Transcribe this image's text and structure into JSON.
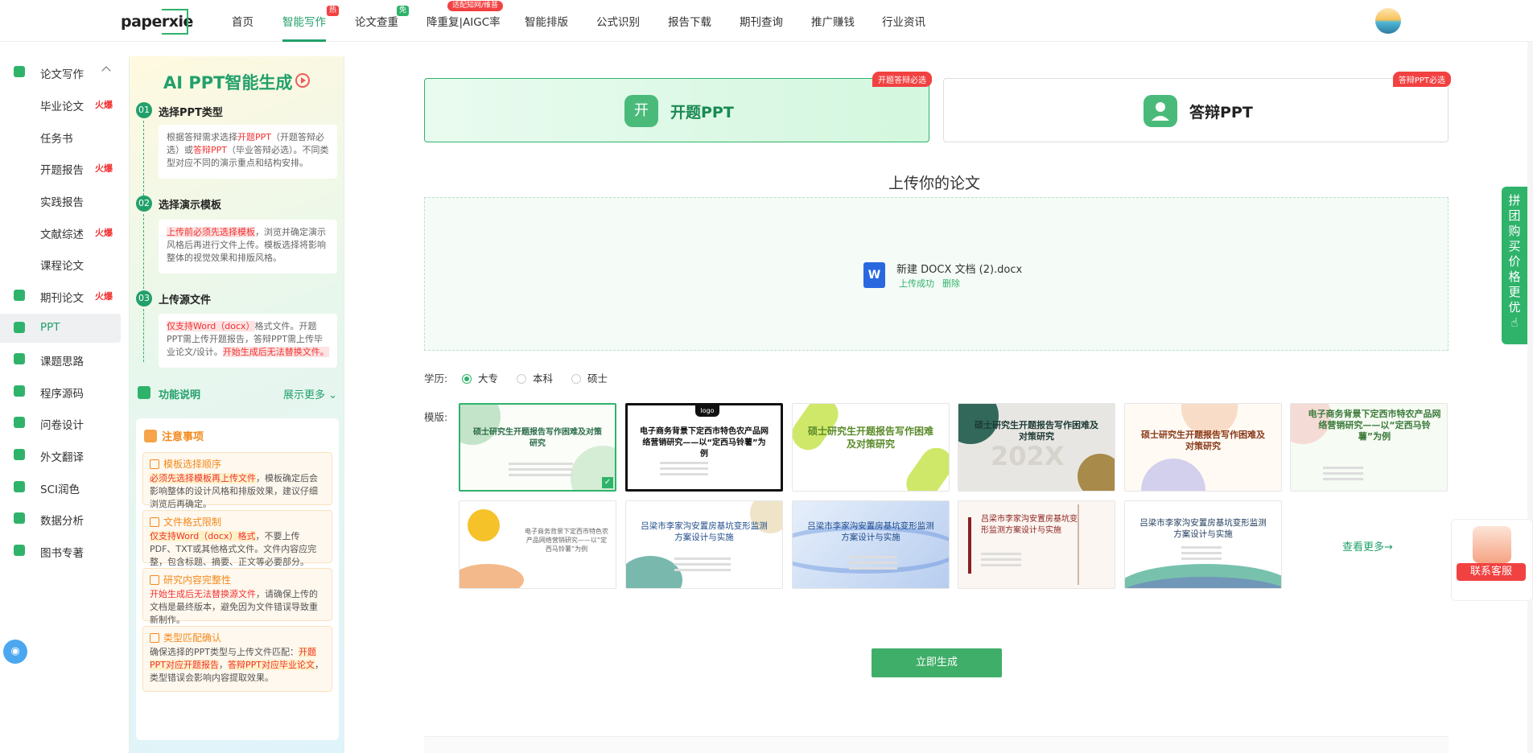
{
  "brand": {
    "logo_text": "paperxie"
  },
  "nav": {
    "items": [
      {
        "label": "首页"
      },
      {
        "label": "智能写作",
        "badge": "热"
      },
      {
        "label": "论文查重",
        "badge": "免"
      },
      {
        "label": "降重复|AIGC率",
        "badge": "适配知网/维普"
      },
      {
        "label": "智能排版"
      },
      {
        "label": "公式识别"
      },
      {
        "label": "报告下载"
      },
      {
        "label": "期刊查询"
      },
      {
        "label": "推广赚钱"
      },
      {
        "label": "行业资讯"
      }
    ]
  },
  "sidebar": {
    "items": [
      {
        "label": "论文写作",
        "hot": ""
      },
      {
        "label": "毕业论文",
        "hot": "火爆"
      },
      {
        "label": "任务书",
        "hot": ""
      },
      {
        "label": "开题报告",
        "hot": "火爆"
      },
      {
        "label": "实践报告",
        "hot": ""
      },
      {
        "label": "文献综述",
        "hot": "火爆"
      },
      {
        "label": "课程论文",
        "hot": ""
      },
      {
        "label": "期刊论文",
        "hot": "火爆"
      },
      {
        "label": "PPT",
        "hot": ""
      },
      {
        "label": "课题思路",
        "hot": ""
      },
      {
        "label": "程序源码",
        "hot": ""
      },
      {
        "label": "问卷设计",
        "hot": ""
      },
      {
        "label": "外文翻译",
        "hot": ""
      },
      {
        "label": "SCI润色",
        "hot": ""
      },
      {
        "label": "数据分析",
        "hot": ""
      },
      {
        "label": "图书专著",
        "hot": ""
      }
    ]
  },
  "guide": {
    "title": "AI PPT智能生成",
    "steps": [
      {
        "num": "01",
        "title": "选择PPT类型",
        "t1": "根据答辩需求选择",
        "t2": "开题PPT",
        "t3": "（开题答辩必选）或",
        "t4": "答辩PPT",
        "t5": "（毕业答辩必选）。不同类型对应不同的演示重点和结构安排。"
      },
      {
        "num": "02",
        "title": "选择演示模板",
        "t1": "上传前必须先选择模板",
        "t2": "，浏览并确定演示风格后再进行文件上传。模板选择将影响整体的视觉效果和排版风格。"
      },
      {
        "num": "03",
        "title": "上传源文件",
        "t1": "仅支持Word（docx）",
        "t2": "格式文件。开题PPT需上传开题报告，答辩PPT需上传毕业论文/设计。",
        "t3": "开始生成后无法替换文件。"
      }
    ],
    "function_label": "功能说明",
    "function_more": "展示更多",
    "notice_title": "注意事项",
    "notices": [
      {
        "title": "模板选择顺序",
        "hl": "必须先选择模板再上传文件",
        "text": "，模板确定后会影响整体的设计风格和排版效果，建议仔细浏览后再确定。"
      },
      {
        "title": "文件格式限制",
        "hl": "仅支持Word（docx）格式",
        "text": "，不要上传PDF、TXT或其他格式文件。文件内容应完整，包含标题、摘要、正文等必要部分。"
      },
      {
        "title": "研究内容完整性",
        "hl": "开始生成后无法替换源文件",
        "text": "，请确保上传的文档是最终版本，避免因为文件错误导致重新制作。"
      },
      {
        "title": "类型匹配确认",
        "t1": "确保选择的PPT类型与上传文件匹配：",
        "hl1": "开题PPT对应开题报告",
        "t2": "，",
        "hl2": "答辩PPT对应毕业论文",
        "t3": "，类型错误会影响内容提取效果。"
      }
    ]
  },
  "ppt_types": [
    {
      "icon": "开",
      "label": "开题PPT",
      "tag": "开题答辩必选"
    },
    {
      "icon": "",
      "label": "答辩PPT",
      "tag": "答辩PPT必选"
    }
  ],
  "upload": {
    "title": "上传你的论文",
    "file_icon": "W",
    "file_name": "新建 DOCX 文档 (2).docx",
    "status": "上传成功",
    "delete": "删除"
  },
  "education": {
    "label": "学历:",
    "options": [
      "大专",
      "本科",
      "硕士"
    ],
    "selected": "大专"
  },
  "templates": {
    "label": "模版:",
    "items": [
      {
        "title": "硕士研究生开题报告写作困难及对策研究"
      },
      {
        "title": "电子商务背景下定西市特色农产品网络营销研究——以“定西马铃薯”为例",
        "logo": "logo"
      },
      {
        "title": "硕士研究生开题报告写作困难及对策研究"
      },
      {
        "title": "硕士研究生开题报告写作困难及对策研究",
        "year": "202X"
      },
      {
        "title": "硕士研究生开题报告写作困难及对策研究"
      },
      {
        "title": "电子商务背景下定西市特农产品网络营销研究——以“定西马铃薯”为例"
      },
      {
        "title": "电子商务背景下定西市特色农产品网络营销研究——以“定西马铃薯”为例"
      },
      {
        "title": "吕梁市李家沟安置房基坑变形监测方案设计与实施"
      },
      {
        "title": "吕梁市李家沟安置房基坑变形监测方案设计与实施"
      },
      {
        "title": "吕梁市李家沟安置房基坑变形监测方案设计与实施"
      },
      {
        "title": "吕梁市李家沟安置房基坑变形监测方案设计与实施"
      }
    ],
    "more": "查看更多→"
  },
  "generate_label": "立即生成",
  "floating": {
    "group_buy": [
      "拼",
      "团",
      "购",
      "买",
      "价",
      "格",
      "更",
      "优"
    ],
    "service": "联系客服"
  },
  "colors": {
    "accent": "#22a06b",
    "hot": "#f23030"
  }
}
